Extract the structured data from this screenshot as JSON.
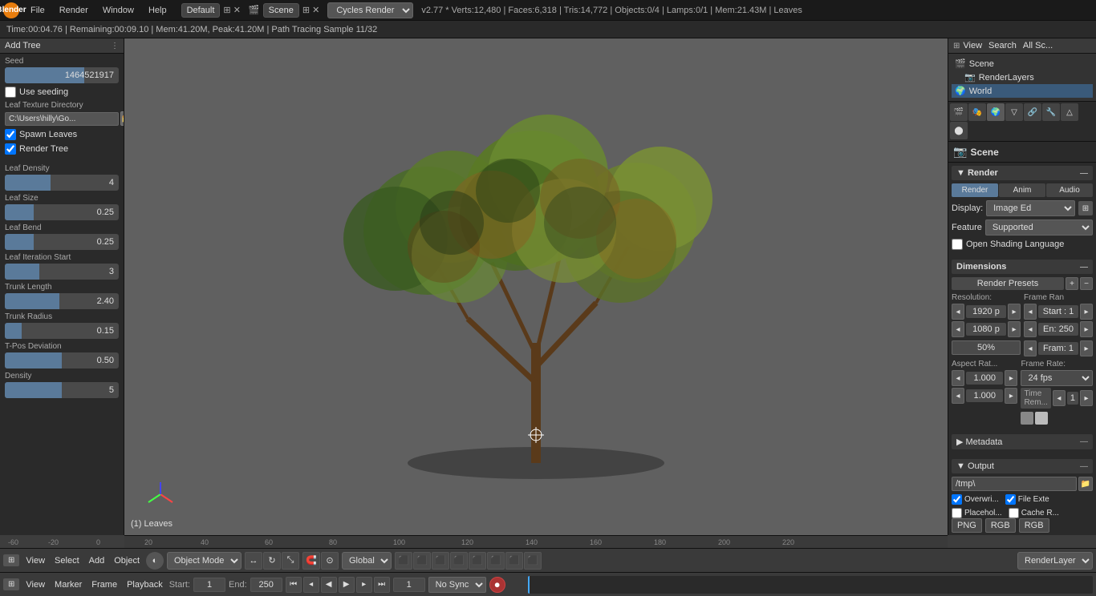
{
  "app": {
    "name": "Blender",
    "version": "v2.77"
  },
  "topbar": {
    "logo": "B",
    "menu": [
      "File",
      "Render",
      "Window",
      "Help"
    ],
    "workspace": "Default",
    "scene": "Scene",
    "engine": "Cycles Render",
    "stats": "v2.77 * Verts:12,480 | Faces:6,318 | Tris:14,772 | Objects:0/4 | Lamps:0/1 | Mem:21.43M | Leaves"
  },
  "infobar": {
    "text": "Time:00:04.76 | Remaining:00:09.10 | Mem:41.20M, Peak:41.20M | Path Tracing Sample 11/32"
  },
  "left_panel": {
    "header": "Add Tree",
    "seed_label": "Seed",
    "seed_value": "1464521917",
    "use_seeding_label": "Use seeding",
    "leaf_texture_dir_label": "Leaf Texture Directory",
    "leaf_texture_path": "C:\\Users\\hilly\\Go...",
    "spawn_leaves_label": "Spawn Leaves",
    "render_tree_label": "Render Tree",
    "leaf_density_label": "Leaf Density",
    "leaf_density_value": "4",
    "leaf_density_fill": 40,
    "leaf_size_label": "Leaf Size",
    "leaf_size_value": "0.25",
    "leaf_size_fill": 25,
    "leaf_bend_label": "Leaf Bend",
    "leaf_bend_value": "0.25",
    "leaf_bend_fill": 25,
    "leaf_iter_label": "Leaf Iteration Start",
    "leaf_iter_value": "3",
    "leaf_iter_fill": 30,
    "trunk_length_label": "Trunk Length",
    "trunk_length_value": "2.40",
    "trunk_length_fill": 48,
    "trunk_radius_label": "Trunk Radius",
    "trunk_radius_value": "0.15",
    "trunk_radius_fill": 15,
    "tpos_label": "T-Pos Deviation",
    "tpos_value": "0.50",
    "tpos_fill": 50,
    "density_label": "Density",
    "density_value": "5",
    "density_fill": 50
  },
  "viewport": {
    "label": "(1) Leaves"
  },
  "bottom_toolbar": {
    "view_label": "View",
    "select_label": "Select",
    "add_label": "Add",
    "object_label": "Object",
    "mode_label": "Object Mode",
    "global_label": "Global",
    "render_layer_label": "RenderLayer"
  },
  "timeline": {
    "view_label": "View",
    "marker_label": "Marker",
    "frame_label": "Frame",
    "playback_label": "Playback",
    "start_label": "Start:",
    "start_value": "1",
    "end_label": "End:",
    "end_value": "250",
    "current_frame": "1",
    "sync_label": "No Sync"
  },
  "right_panel": {
    "scene_title": "Scene",
    "scene_items": [
      {
        "name": "Scene",
        "type": "scene"
      },
      {
        "name": "RenderLayers",
        "type": "render"
      },
      {
        "name": "World",
        "type": "world"
      }
    ],
    "render_tabs": [
      "Render",
      "Anim",
      "Audio"
    ],
    "display_label": "Display:",
    "display_value": "Image Ed",
    "feature_label": "Feature",
    "feature_value": "Supported",
    "open_shading_label": "Open Shading Language",
    "dimensions_title": "Dimensions",
    "render_presets_label": "Render Presets",
    "resolution_label": "Resolution:",
    "frame_range_label": "Frame Ran",
    "res_x": "1920 p",
    "res_y": "1080 p",
    "res_percent": "50%",
    "start_frame": "Start : 1",
    "end_frame": "En: 250",
    "current_frame_val": "Fram: 1",
    "aspect_label": "Aspect Rat...",
    "fps_label": "Frame Rate:",
    "aspect_x": "1.000",
    "aspect_y": "1.000",
    "fps_value": "24 fps",
    "time_rem_label": "Time Rem...",
    "time_rem_value": "1",
    "metadata_title": "Metadata",
    "output_title": "Output",
    "output_path": "/tmp\\",
    "overwrite_label": "Overwri...",
    "file_ext_label": "File Exte",
    "placeholder_label": "Placehol...",
    "cache_label": "Cache R...",
    "format_labels": [
      "PNG",
      "RGB",
      "RGB"
    ]
  }
}
